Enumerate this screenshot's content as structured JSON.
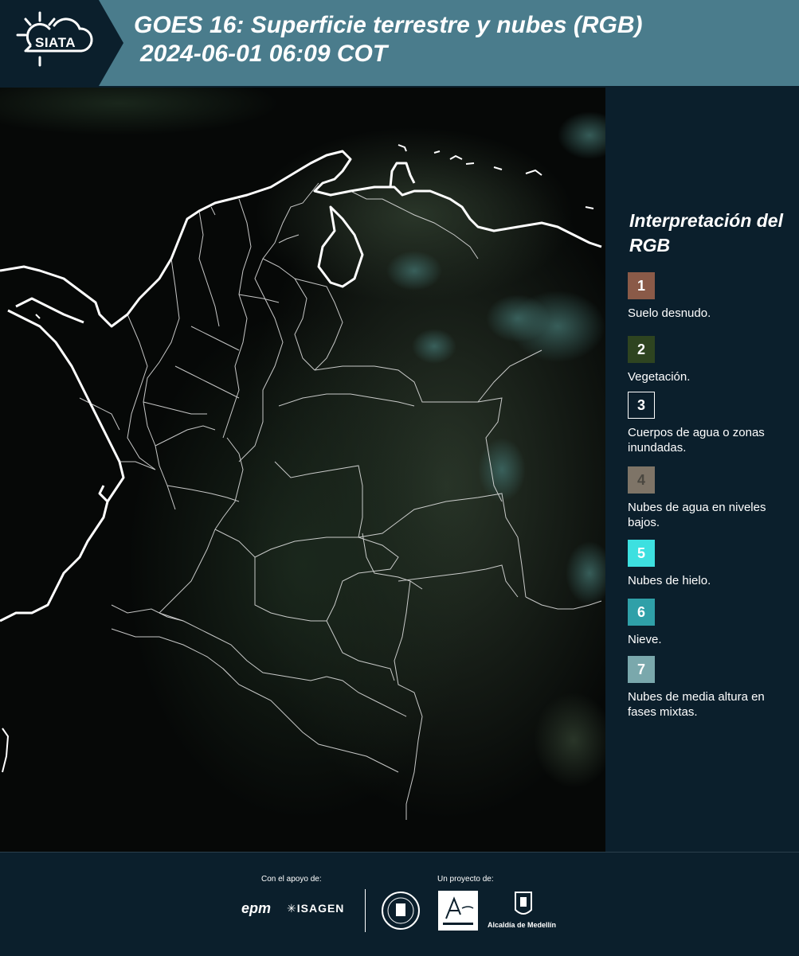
{
  "header": {
    "logo_text": "SIATA",
    "title_line1": "GOES 16: Superficie terrestre y nubes (RGB)",
    "title_line2": "2024-06-01 06:09 COT"
  },
  "legend": {
    "title": "Interpretación del RGB",
    "items": [
      {
        "num": "1",
        "label": "Suelo desnudo.",
        "color": "#8a5a48",
        "border": "#8a5a48",
        "text_color": "#ffffff"
      },
      {
        "num": "2",
        "label": "Vegetación.",
        "color": "#2e4420",
        "border": "#2e4420",
        "text_color": "#ffffff"
      },
      {
        "num": "3",
        "label": "Cuerpos de agua o zonas inundadas.",
        "color": "#0b1f2c",
        "border": "#ffffff",
        "text_color": "#ffffff"
      },
      {
        "num": "4",
        "label": "Nubes de agua en niveles bajos.",
        "color": "#7e7467",
        "border": "#7e7467",
        "text_color": "#4a4740"
      },
      {
        "num": "5",
        "label": "Nubes de hielo.",
        "color": "#3de0e0",
        "border": "#3de0e0",
        "text_color": "#ffffff"
      },
      {
        "num": "6",
        "label": "Nieve.",
        "color": "#2fa0a8",
        "border": "#2fa0a8",
        "text_color": "#ffffff"
      },
      {
        "num": "7",
        "label": "Nubes de media altura en fases mixtas.",
        "color": "#7aa8ac",
        "border": "#7aa8ac",
        "text_color": "#ffffff"
      }
    ]
  },
  "footer": {
    "support_label": "Con el apoyo de:",
    "project_label": "Un proyecto de:",
    "sponsors": [
      "epm",
      "ISAGEN"
    ],
    "partners": [
      "Área Metropolitana Valle de Aburrá",
      "Alcaldía de Medellín"
    ]
  }
}
